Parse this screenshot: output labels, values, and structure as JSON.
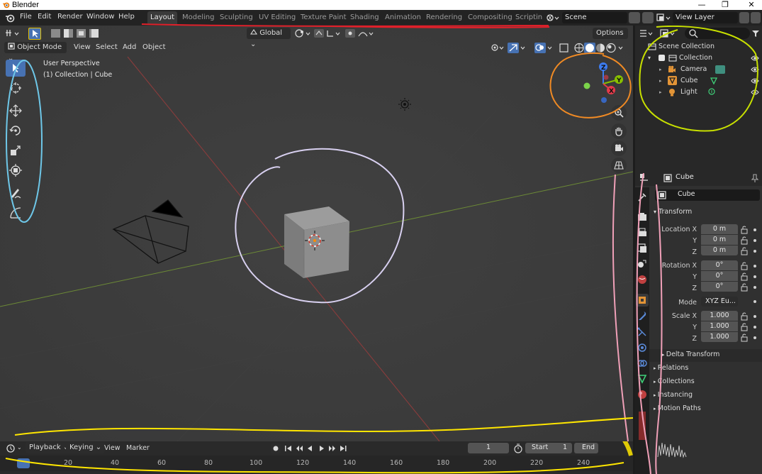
{
  "window": {
    "title": "Blender",
    "min_icon": "—",
    "max_icon": "❐",
    "close_icon": "✕"
  },
  "menu": [
    "File",
    "Edit",
    "Render",
    "Window",
    "Help"
  ],
  "workspaces": [
    "Layout",
    "Modeling",
    "Sculpting",
    "UV Editing",
    "Texture Paint",
    "Shading",
    "Animation",
    "Rendering",
    "Compositing",
    "Scriptin"
  ],
  "active_workspace": "Layout",
  "scene": {
    "label": "Scene",
    "view_layer": "View Layer"
  },
  "viewport": {
    "transform_orientation": "Global",
    "options": "Options",
    "mode": "Object Mode",
    "menus": [
      "View",
      "Select",
      "Add",
      "Object"
    ],
    "overlay_title": "User Perspective",
    "overlay_subtitle": "(1) Collection | Cube",
    "gizmo": {
      "z": "Z",
      "y": "Y",
      "x": "X"
    }
  },
  "outliner": {
    "search_placeholder": "",
    "root": "Scene Collection",
    "collection": "Collection",
    "items": [
      "Camera",
      "Cube",
      "Light"
    ]
  },
  "properties": {
    "header_object": "Cube",
    "object_name": "Cube",
    "transform_title": "Transform",
    "location": {
      "label": "Location X",
      "x": "0 m",
      "y": "0 m",
      "z": "0 m"
    },
    "rotation": {
      "label": "Rotation X",
      "x": "0°",
      "y": "0°",
      "z": "0°"
    },
    "mode": {
      "label": "Mode",
      "value": "XYZ Eu..."
    },
    "scale": {
      "label": "Scale X",
      "x": "1.000",
      "y": "1.000",
      "z": "1.000"
    },
    "axis_y": "Y",
    "axis_z": "Z",
    "sections": [
      "Delta Transform",
      "Relations",
      "Collections",
      "Instancing",
      "Motion Paths"
    ]
  },
  "timeline": {
    "menus": [
      "Playback",
      "Keying",
      "View",
      "Marker"
    ],
    "current_frame": "1",
    "start_label": "Start",
    "start_value": "1",
    "end_label": "End",
    "ticks": [
      "20",
      "40",
      "60",
      "80",
      "100",
      "120",
      "140",
      "160",
      "180",
      "200",
      "220",
      "240"
    ]
  },
  "colors": {
    "accent": "#4772b3",
    "annotation_red": "#e0202a",
    "annotation_orange": "#f08a24",
    "annotation_lime": "#c8e000",
    "annotation_cyan": "#6ec7e8",
    "annotation_pink": "#f0a0b8",
    "annotation_yellow": "#ffe600",
    "annotation_lavender": "#d8d0f0"
  }
}
